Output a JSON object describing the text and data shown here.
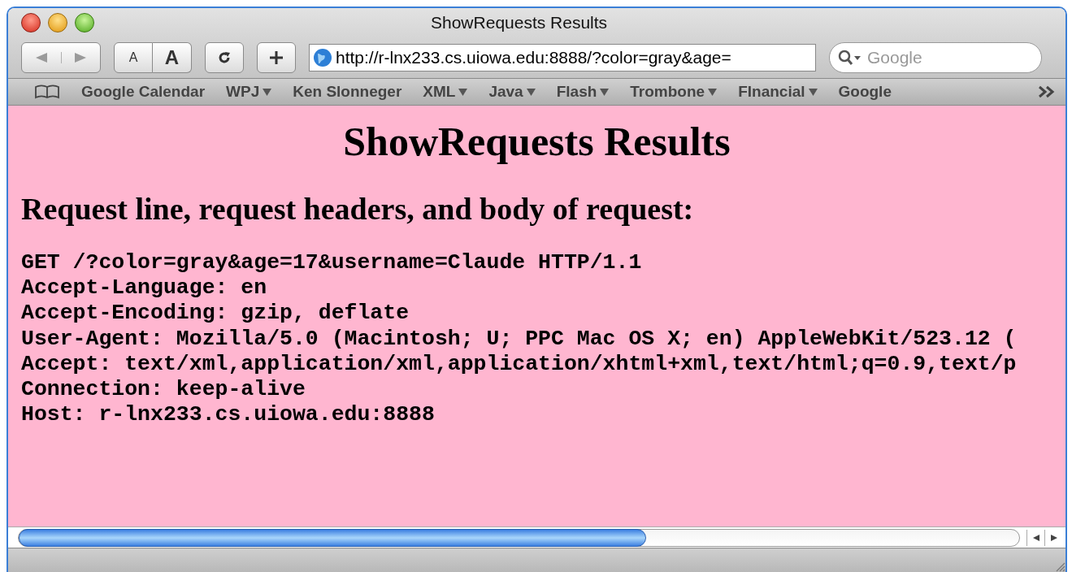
{
  "window": {
    "title": "ShowRequests Results"
  },
  "toolbar": {
    "nav_buttons": [
      {
        "kind": "back",
        "disabled": true
      },
      {
        "kind": "forward",
        "disabled": true
      }
    ],
    "text_size_buttons": [
      {
        "label": "A",
        "kind": "smaller"
      },
      {
        "label": "A",
        "kind": "larger"
      }
    ],
    "address": "http://r-lnx233.cs.uiowa.edu:8888/?color=gray&age=",
    "search": {
      "placeholder": "Google"
    }
  },
  "bookmarks": [
    {
      "label": "Google Calendar",
      "kind": "link"
    },
    {
      "label": "WPJ",
      "kind": "menu"
    },
    {
      "label": "Ken Slonneger",
      "kind": "link"
    },
    {
      "label": "XML",
      "kind": "menu"
    },
    {
      "label": "Java",
      "kind": "menu"
    },
    {
      "label": "Flash",
      "kind": "menu"
    },
    {
      "label": "Trombone",
      "kind": "menu"
    },
    {
      "label": "FInancial",
      "kind": "menu"
    },
    {
      "label": "Google",
      "kind": "link"
    }
  ],
  "page": {
    "heading": "ShowRequests Results",
    "subheading": "Request line, request headers, and body of request:",
    "lines": [
      "GET /?color=gray&age=17&username=Claude HTTP/1.1",
      "Accept-Language: en",
      "Accept-Encoding: gzip, deflate",
      "User-Agent: Mozilla/5.0 (Macintosh; U; PPC Mac OS X; en) AppleWebKit/523.12 (",
      "Accept: text/xml,application/xml,application/xhtml+xml,text/html;q=0.9,text/p",
      "Connection: keep-alive",
      "Host: r-lnx233.cs.uiowa.edu:8888"
    ]
  }
}
